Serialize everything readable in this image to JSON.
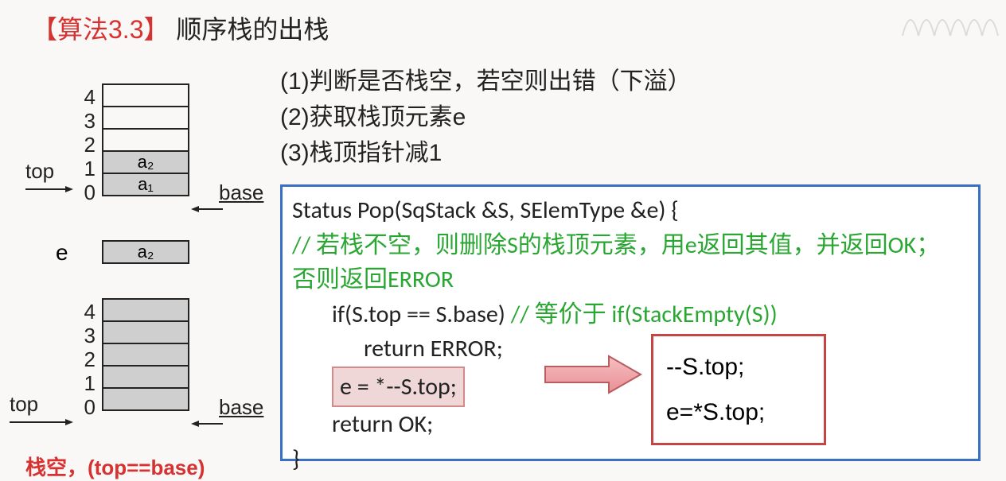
{
  "title": {
    "red": "【算法3.3】",
    "black": "顺序栈的出栈"
  },
  "steps": {
    "s1": "(1)判断是否栈空，若空则出错（下溢）",
    "s2": "(2)获取栈顶元素e",
    "s3": "(3)栈顶指针减1"
  },
  "stack1": {
    "idx": [
      "4",
      "3",
      "2",
      "1",
      "0"
    ],
    "cells": [
      "",
      "",
      "",
      "a₂",
      "a₁"
    ],
    "top_label": "top",
    "base_label": "base"
  },
  "popped": {
    "e_label": "e",
    "value": "a₂"
  },
  "stack2": {
    "idx": [
      "4",
      "3",
      "2",
      "1",
      "0"
    ],
    "top_label": "top",
    "base_label": "base"
  },
  "bottom_note": "栈空，(top==base)",
  "code": {
    "sig": "Status Pop(SqStack &S, SElemType &e) {",
    "c1": "// 若栈不空，则删除S的栈顶元素，用e返回其值，并返回OK；",
    "c2": "否则返回ERROR",
    "l1a": "if(S.top == S.base)",
    "l1c": "  // 等价于 if(StackEmpty(S))",
    "l2": "return ERROR;",
    "hl": "e = *--S.top;",
    "l4": "return OK;",
    "end": "}"
  },
  "breakdown": {
    "b1": "--S.top;",
    "b2": "e=*S.top;"
  }
}
